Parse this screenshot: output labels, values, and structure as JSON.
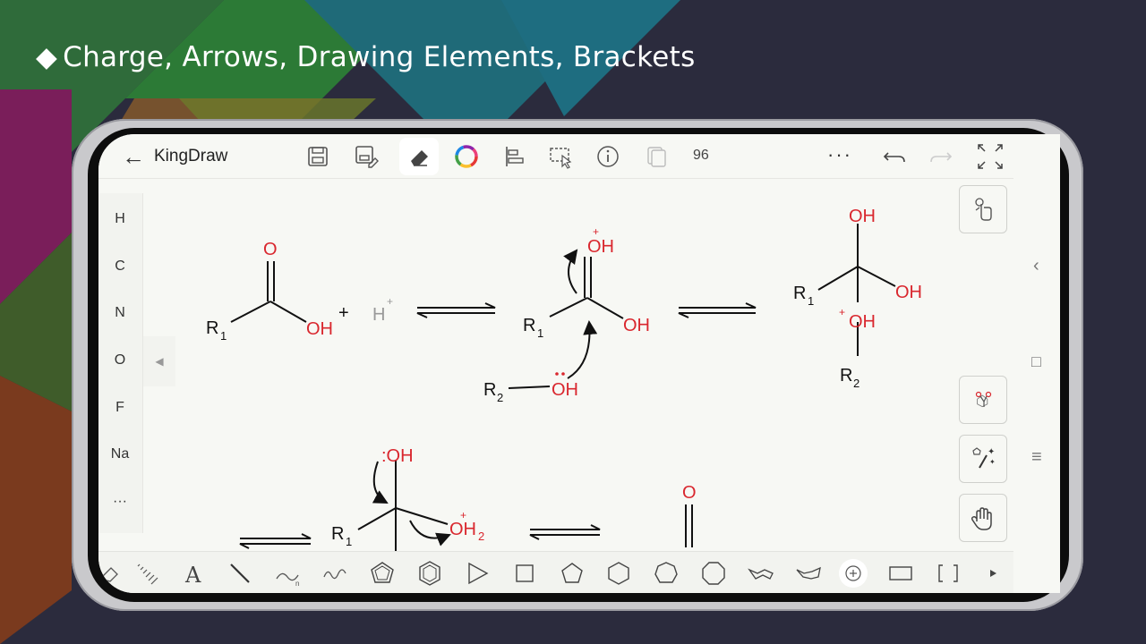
{
  "slide": {
    "title": "Charge, Arrows, Drawing Elements, Brackets",
    "bullet": "◆"
  },
  "app": {
    "name": "KingDraw",
    "zoom": "96",
    "more_label": "···"
  },
  "atoms": [
    "H",
    "C",
    "N",
    "O",
    "F",
    "Na",
    "···"
  ],
  "molecules": {
    "r1": "R",
    "r2": "R",
    "sub1": "1",
    "sub2": "2",
    "o": "O",
    "oh": "OH",
    "plus_sign": "+",
    "h": "H",
    "charge": "+",
    "lone_pair_oh": ":OH",
    "oh2": "OH"
  },
  "colors": {
    "heteroatom": "#d9272e",
    "bond": "#111111",
    "screen": "#f7f8f4",
    "toolbar": "#f2f3ef"
  },
  "toolbar_icons": [
    "save-icon",
    "save-as-icon",
    "eraser-icon",
    "color-wheel-icon",
    "align-icon",
    "select-icon",
    "info-icon",
    "copy-icon",
    "more-icon",
    "undo-icon",
    "redo-icon",
    "fullscreen-icon"
  ],
  "bottom_tools": [
    "eraser-icon",
    "hash-bond-icon",
    "text-icon",
    "line-icon",
    "curve-arrow-icon",
    "wavy-line-icon",
    "pentagon-ring-icon",
    "benzene-ring-icon",
    "triangle-icon",
    "square-icon",
    "pentagon-icon",
    "hexagon-icon",
    "heptagon-icon",
    "octagon-icon",
    "chair-icon",
    "boat-icon",
    "charge-icon",
    "rectangle-icon",
    "bracket-icon",
    "next-icon"
  ]
}
